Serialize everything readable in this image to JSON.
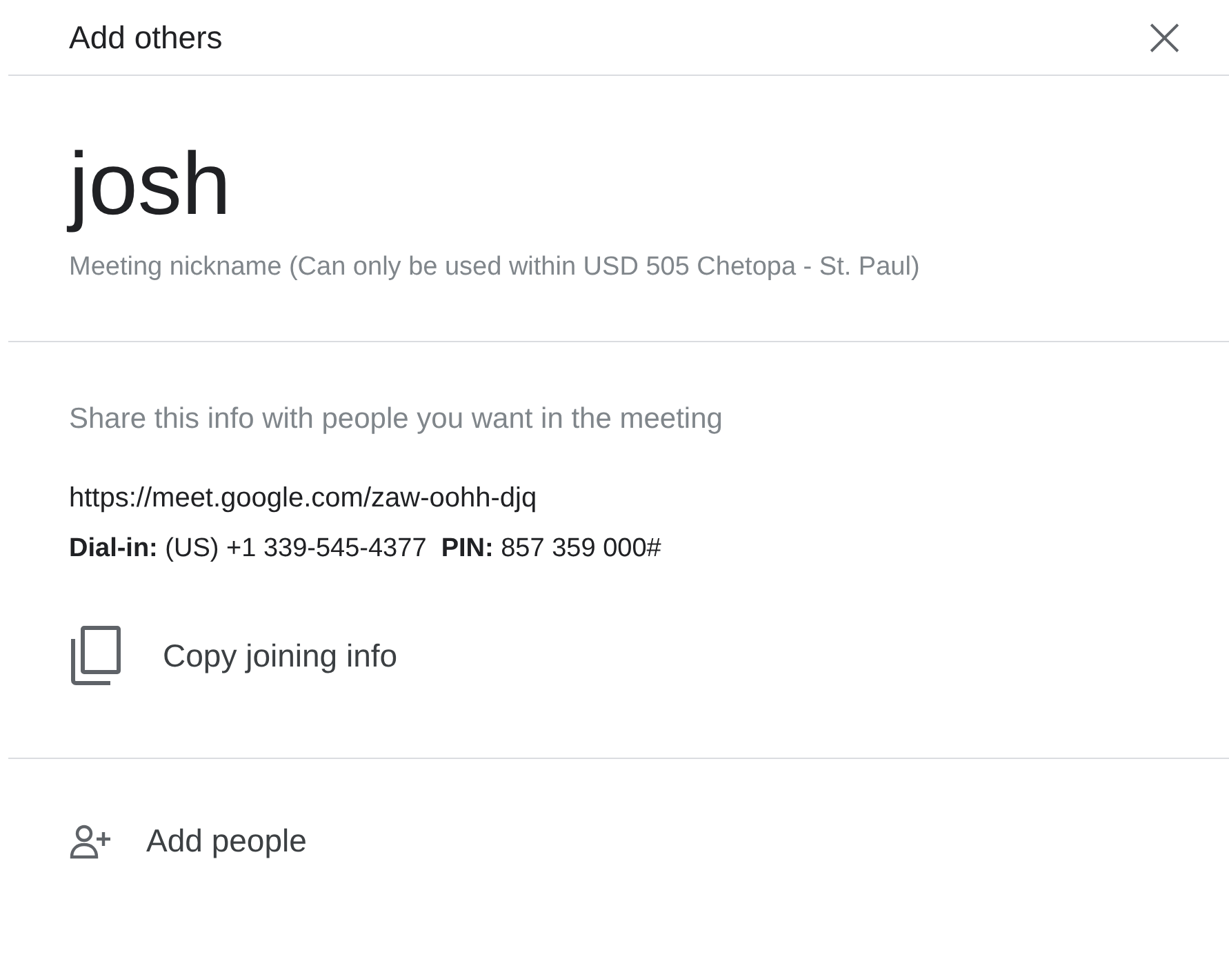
{
  "header": {
    "title": "Add others",
    "close": "×"
  },
  "meeting": {
    "name": "josh",
    "caption": "Meeting nickname (Can only be used within USD 505 Chetopa - St. Paul)"
  },
  "share": {
    "intro": "Share this info with people you want in the meeting",
    "link": "https://meet.google.com/zaw-oohh-djq",
    "dial_in": "**Dial-in:** (US) +1 339-545-4377  **PIN:** 857 359 000#",
    "copy_label": "Copy joining info"
  },
  "actions": [
    {
      "kind": "add-people",
      "label": "Add people"
    }
  ]
}
